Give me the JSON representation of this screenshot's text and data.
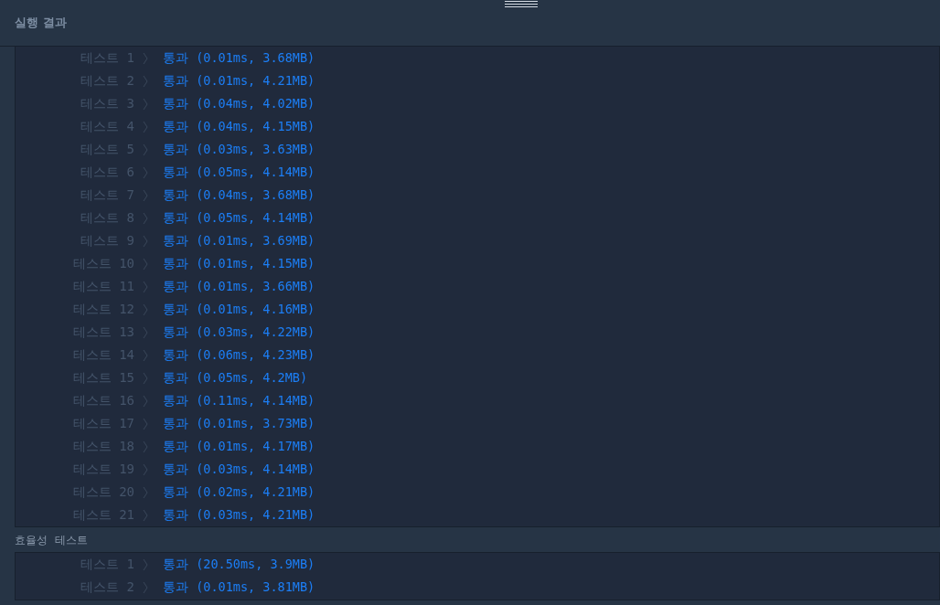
{
  "header": {
    "title": "실행 결과"
  },
  "sections": [
    {
      "rows": [
        {
          "label": "테스트 1",
          "result": "통과 (0.01ms, 3.68MB)"
        },
        {
          "label": "테스트 2",
          "result": "통과 (0.01ms, 4.21MB)"
        },
        {
          "label": "테스트 3",
          "result": "통과 (0.04ms, 4.02MB)"
        },
        {
          "label": "테스트 4",
          "result": "통과 (0.04ms, 4.15MB)"
        },
        {
          "label": "테스트 5",
          "result": "통과 (0.03ms, 3.63MB)"
        },
        {
          "label": "테스트 6",
          "result": "통과 (0.05ms, 4.14MB)"
        },
        {
          "label": "테스트 7",
          "result": "통과 (0.04ms, 3.68MB)"
        },
        {
          "label": "테스트 8",
          "result": "통과 (0.05ms, 4.14MB)"
        },
        {
          "label": "테스트 9",
          "result": "통과 (0.01ms, 3.69MB)"
        },
        {
          "label": "테스트 10",
          "result": "통과 (0.01ms, 4.15MB)"
        },
        {
          "label": "테스트 11",
          "result": "통과 (0.01ms, 3.66MB)"
        },
        {
          "label": "테스트 12",
          "result": "통과 (0.01ms, 4.16MB)"
        },
        {
          "label": "테스트 13",
          "result": "통과 (0.03ms, 4.22MB)"
        },
        {
          "label": "테스트 14",
          "result": "통과 (0.06ms, 4.23MB)"
        },
        {
          "label": "테스트 15",
          "result": "통과 (0.05ms, 4.2MB)"
        },
        {
          "label": "테스트 16",
          "result": "통과 (0.11ms, 4.14MB)"
        },
        {
          "label": "테스트 17",
          "result": "통과 (0.01ms, 3.73MB)"
        },
        {
          "label": "테스트 18",
          "result": "통과 (0.01ms, 4.17MB)"
        },
        {
          "label": "테스트 19",
          "result": "통과 (0.03ms, 4.14MB)"
        },
        {
          "label": "테스트 20",
          "result": "통과 (0.02ms, 4.21MB)"
        },
        {
          "label": "테스트 21",
          "result": "통과 (0.03ms, 4.21MB)"
        }
      ]
    },
    {
      "title": "효율성  테스트",
      "rows": [
        {
          "label": "테스트 1",
          "result": "통과 (20.50ms, 3.9MB)"
        },
        {
          "label": "테스트 2",
          "result": "통과 (0.01ms, 3.81MB)"
        }
      ]
    }
  ]
}
